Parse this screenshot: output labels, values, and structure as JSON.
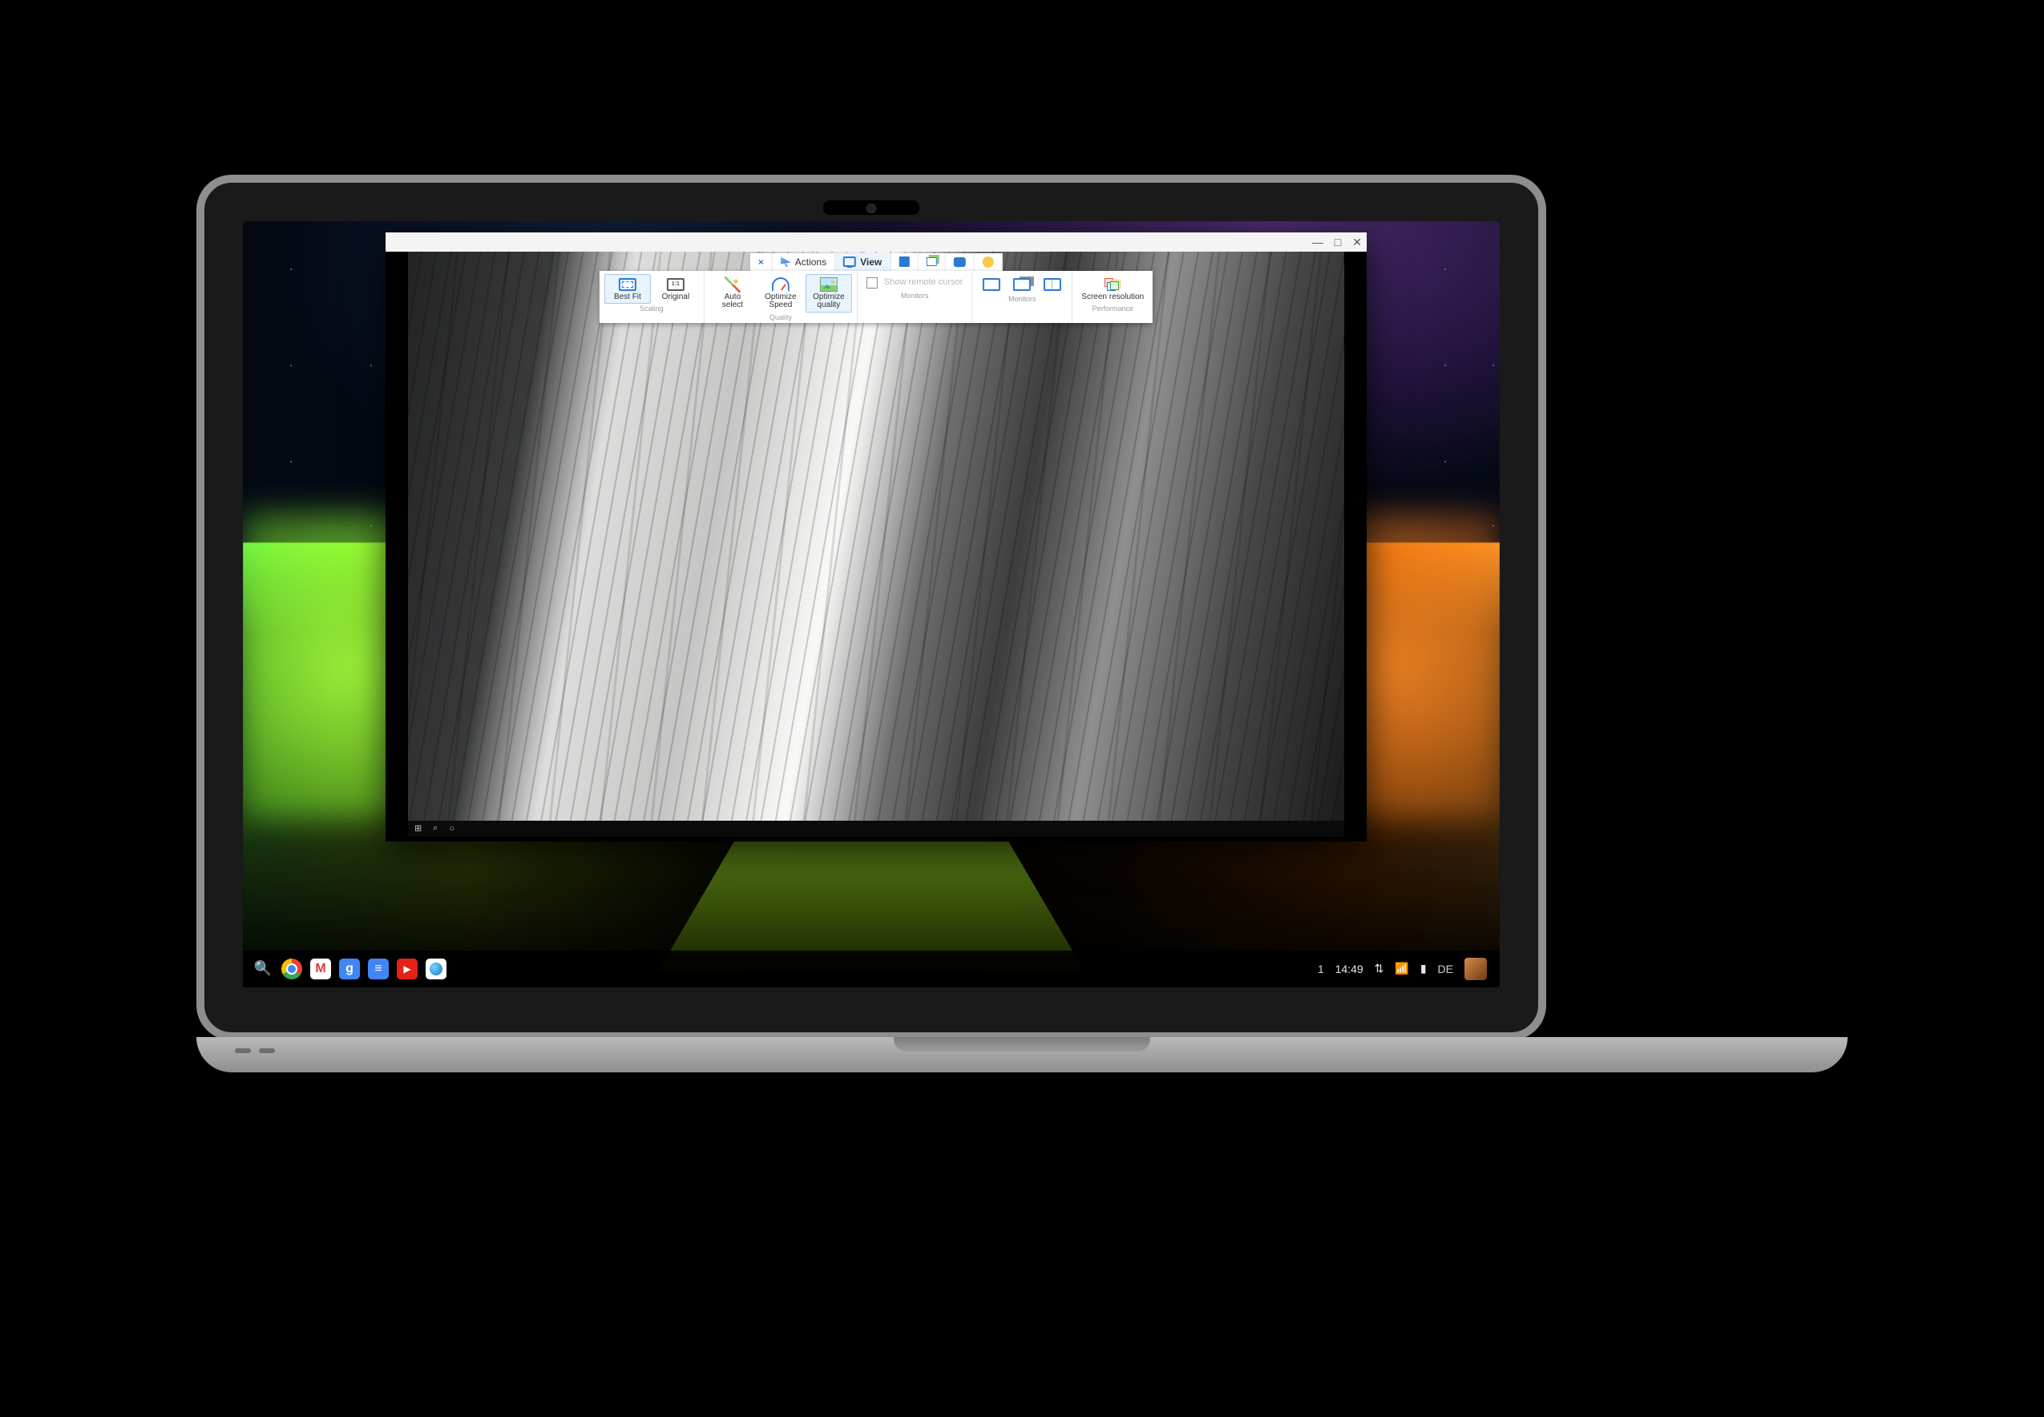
{
  "shelf": {
    "search_icon": "launcher-search",
    "apps": [
      {
        "id": "chrome",
        "name": "Chrome"
      },
      {
        "id": "gmail",
        "name": "Gmail",
        "glyph": "M"
      },
      {
        "id": "google",
        "name": "Google Search",
        "glyph": "g"
      },
      {
        "id": "docs",
        "name": "Google Docs",
        "glyph": "≡"
      },
      {
        "id": "youtube",
        "name": "YouTube",
        "glyph": "▶"
      },
      {
        "id": "teamviewer",
        "name": "TeamViewer"
      }
    ],
    "tray": {
      "notification_count": "1",
      "time": "14:49",
      "nearby_icon": "nearby-share",
      "wifi_icon": "wifi-full",
      "battery_icon": "battery",
      "locale": "DE",
      "avatar": "user-avatar"
    }
  },
  "tv": {
    "window_controls": {
      "minimize": "—",
      "maximize": "□",
      "close": "✕"
    },
    "tabs": {
      "close_session": "×",
      "actions": "Actions",
      "view": "View"
    },
    "ribbon": {
      "scaling": {
        "group": "Scaling",
        "best_fit": "Best Fit",
        "original": "Original"
      },
      "quality": {
        "group": "Quality",
        "auto": "Auto\nselect",
        "speed": "Optimize\nSpeed",
        "qual": "Optimize\nquality"
      },
      "cursor": {
        "label": "Show remote cursor"
      },
      "monitors": {
        "group": "Monitors"
      },
      "performance": {
        "group": "Performance",
        "res": "Screen resolution"
      }
    },
    "remote_taskbar": {
      "start": "⊞",
      "search": "⌕",
      "cortana": "○"
    }
  }
}
